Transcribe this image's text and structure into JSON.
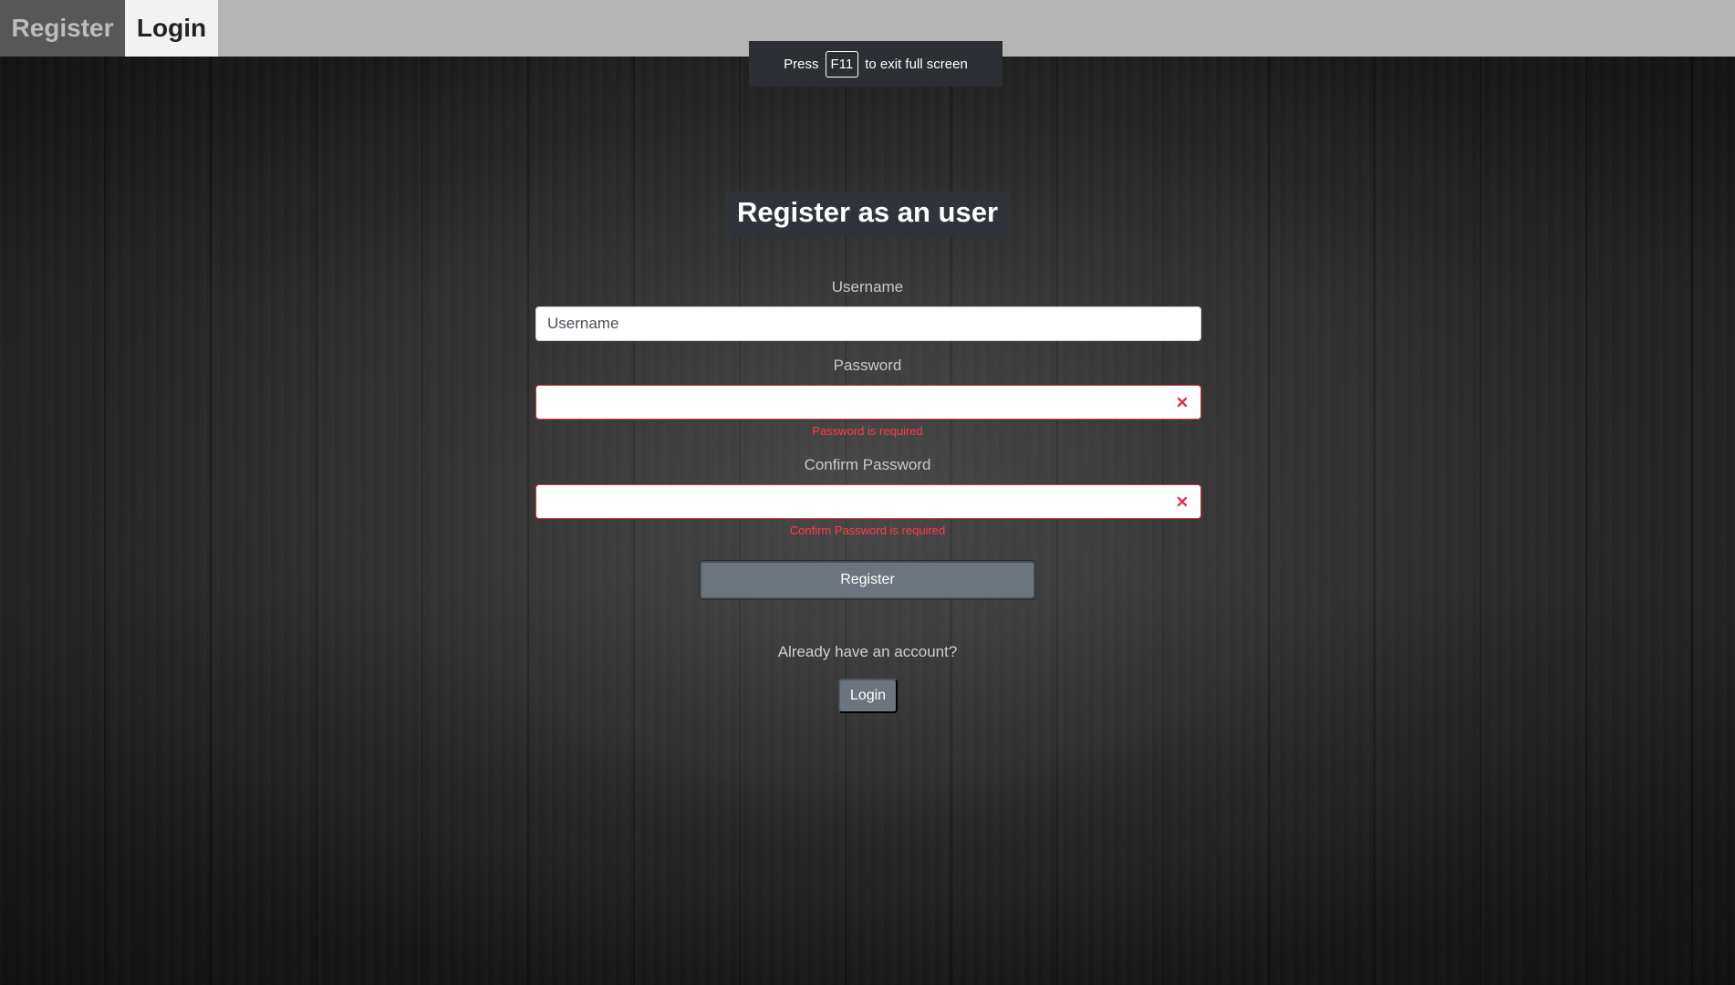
{
  "nav": {
    "register_label": "Register",
    "login_label": "Login"
  },
  "fullscreen_notice": {
    "before": "Press",
    "key": "F11",
    "after": "to exit full screen"
  },
  "form": {
    "heading": "Register as an user",
    "username": {
      "label": "Username",
      "placeholder": "Username",
      "value": ""
    },
    "password": {
      "label": "Password",
      "value": "",
      "error": "Password is required",
      "icon": "error-x-icon"
    },
    "confirm_password": {
      "label": "Confirm Password",
      "value": "",
      "error": "Confirm Password is required",
      "icon": "error-x-icon"
    },
    "submit_label": "Register",
    "already_text": "Already have an account?",
    "login_label": "Login"
  },
  "colors": {
    "error": "#dc3545",
    "button": "#6c757d",
    "topbar": "#b5b5b5"
  }
}
